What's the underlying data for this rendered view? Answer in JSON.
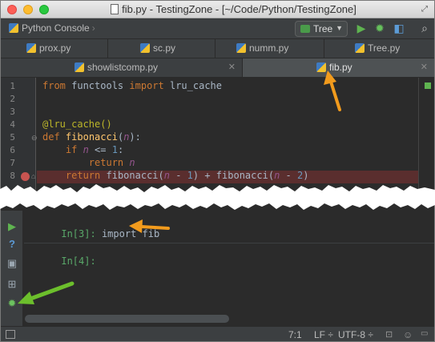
{
  "window": {
    "title": "fib.py - TestingZone - [~/Code/Python/TestingZone]"
  },
  "toolbar": {
    "breadcrumb": "Python Console",
    "run_config": "Tree",
    "icons": [
      "run-icon",
      "debug-icon",
      "coverage-icon",
      "search-icon"
    ]
  },
  "tabs_row1": [
    {
      "label": "prox.py"
    },
    {
      "label": "sc.py"
    },
    {
      "label": "numm.py"
    },
    {
      "label": "Tree.py"
    }
  ],
  "tabs_row2": [
    {
      "label": "showlistcomp.py",
      "active": false
    },
    {
      "label": "fib.py",
      "active": true
    }
  ],
  "editor": {
    "line_numbers": [
      "1",
      "2",
      "3",
      "4",
      "5",
      "6",
      "7",
      "8"
    ],
    "breakpoint_line": "8"
  },
  "console": {
    "lines": [
      {
        "prompt": "In[3]:",
        "code": "import fib"
      },
      {
        "prompt": "In[4]:",
        "code": ""
      }
    ]
  },
  "status": {
    "position": "7:1",
    "line_sep": "LF",
    "encoding": "UTF-8"
  },
  "colors": {
    "annotation_orange": "#f29b1d",
    "annotation_green": "#6cbf2c",
    "breakpoint": "#c75450"
  }
}
